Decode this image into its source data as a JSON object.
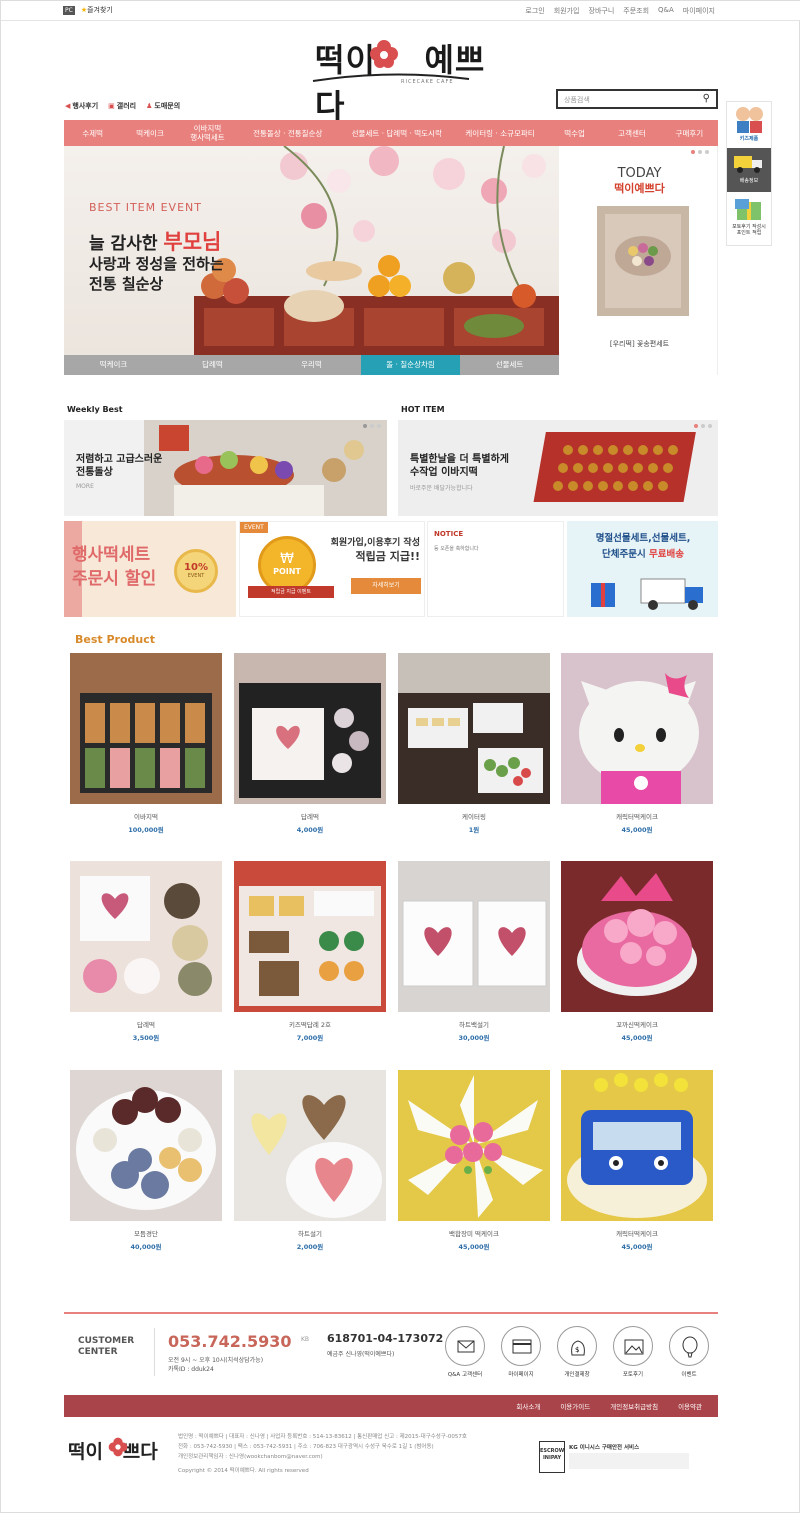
{
  "topbar": {
    "pc": "PC",
    "favorite": "즐겨찾기",
    "links": [
      "로그인",
      "회원가입",
      "장바구니",
      "주문조회",
      "Q&A",
      "마이페이지"
    ]
  },
  "logo": {
    "text": "떡이 예쁘다",
    "sub": "RICECAKE CAFE"
  },
  "quick": [
    "행사후기",
    "갤러리",
    "도매문의"
  ],
  "search": {
    "placeholder": "상품검색"
  },
  "nav": [
    "수제떡",
    "떡케이크",
    "이바지떡\n행사떡세트",
    "전통돌상 · 전통칠순상",
    "선물세트 · 답례떡 · 떡도시락",
    "케이터링 · 소규모파티",
    "떡수업",
    "고객센터",
    "구매후기"
  ],
  "hero": {
    "eyebrow": "BEST  ITEM  EVENT",
    "line1a": "늘 감사한 ",
    "line1b": "부모님",
    "line2": "사랑과 정성을 전하는",
    "line3": "전통 칠순상",
    "tabs": [
      "떡케이크",
      "답례떡",
      "우리떡",
      "돌 · 칠순상차림",
      "선물세트"
    ]
  },
  "today": {
    "title": "TODAY",
    "brand": "떡이예쁘다",
    "caption": "[우리떡] 꽃송편세트"
  },
  "side": [
    "키즈제품",
    "배송정보",
    "포토후기 작성시\n포인트 적립"
  ],
  "weekly": {
    "label": "Weekly Best",
    "line1": "저렴하고 고급스러운",
    "line2": "전통돌상",
    "more": "MORE"
  },
  "hot": {
    "label": "HOT ITEM",
    "line1": "특별한날을 더 특별하게",
    "line2": "수작업 이바지떡",
    "sub": "바로주문 배달가능합니다"
  },
  "banners": {
    "b1": {
      "line1": "행사떡세트",
      "line2": "주문시 할인",
      "badge": "10%",
      "badge2": "EVENT"
    },
    "b2": {
      "tag": "EVENT",
      "coin": "POINT",
      "ribbon": "적립금 지급 이벤트",
      "line1": "회원가입,이용후기 작성",
      "line2": "적립금 지급!!",
      "btn": "자세히보기"
    },
    "b3": {
      "title": "NOTICE",
      "text": "등 오픈을 축하합니다"
    },
    "b4": {
      "line1": "명절선물세트,선물세트,",
      "line2a": "단체주문시 ",
      "line2b": "무료배송"
    }
  },
  "best": {
    "label": "Best Product"
  },
  "products": [
    {
      "name": "이바지떡",
      "price": "100,000원"
    },
    {
      "name": "답례떡",
      "price": "4,000원"
    },
    {
      "name": "케이터링",
      "price": "1원"
    },
    {
      "name": "캐릭터떡케이크",
      "price": "45,000원"
    },
    {
      "name": "답례떡",
      "price": "3,500원"
    },
    {
      "name": "키즈떡답례 2호",
      "price": "7,000원"
    },
    {
      "name": "하트백설기",
      "price": "30,000원"
    },
    {
      "name": "꼬까신떡케이크",
      "price": "45,000원"
    },
    {
      "name": "모듬경단",
      "price": "40,000원"
    },
    {
      "name": "하트설기",
      "price": "2,000원"
    },
    {
      "name": "백합장미 떡케이크",
      "price": "45,000원"
    },
    {
      "name": "캐릭터떡케이크",
      "price": "45,000원"
    }
  ],
  "footer": {
    "cc1": "CUSTOMER",
    "cc2": "CENTER",
    "phone": "053.742.5930",
    "hours1": "오전 9시 ~ 오후 10시(치석상담가능)",
    "hours2": "카톡ID : dduk24",
    "bank": "KB",
    "bankno": "618701-04-173072",
    "bankown": "예금주 신나영(떡이예쁘다)",
    "icons": [
      "Q&A 고객센터",
      "마이페이지",
      "개인결제창",
      "포토후기",
      "이벤트"
    ],
    "nav": [
      "회사소개",
      "이용가이드",
      "개인정보취급방침",
      "이용약관"
    ],
    "info1": "법인명 : 떡이예쁘다  |  대표자 : 신나영  |  사업자 등록번호 : 514-13-83612  |  통신판매업 신고 : 제2015-대구수성구-0057호",
    "info2": "전화 : 053-742-5930  |  팩스 : 053-742-5931  |  주소 : 706-823 대구광역시 수성구 욱수로 1길 1 (범어동)",
    "info3": "개인정보관리책임자 : 신나영(wookchanbom@naver.com)",
    "copy": "Copyright © 2014 떡이예쁘다. All rights reserved",
    "escrow": "ESCROW INIPAY",
    "kg": "KG 이니시스 구매안전 서비스"
  }
}
